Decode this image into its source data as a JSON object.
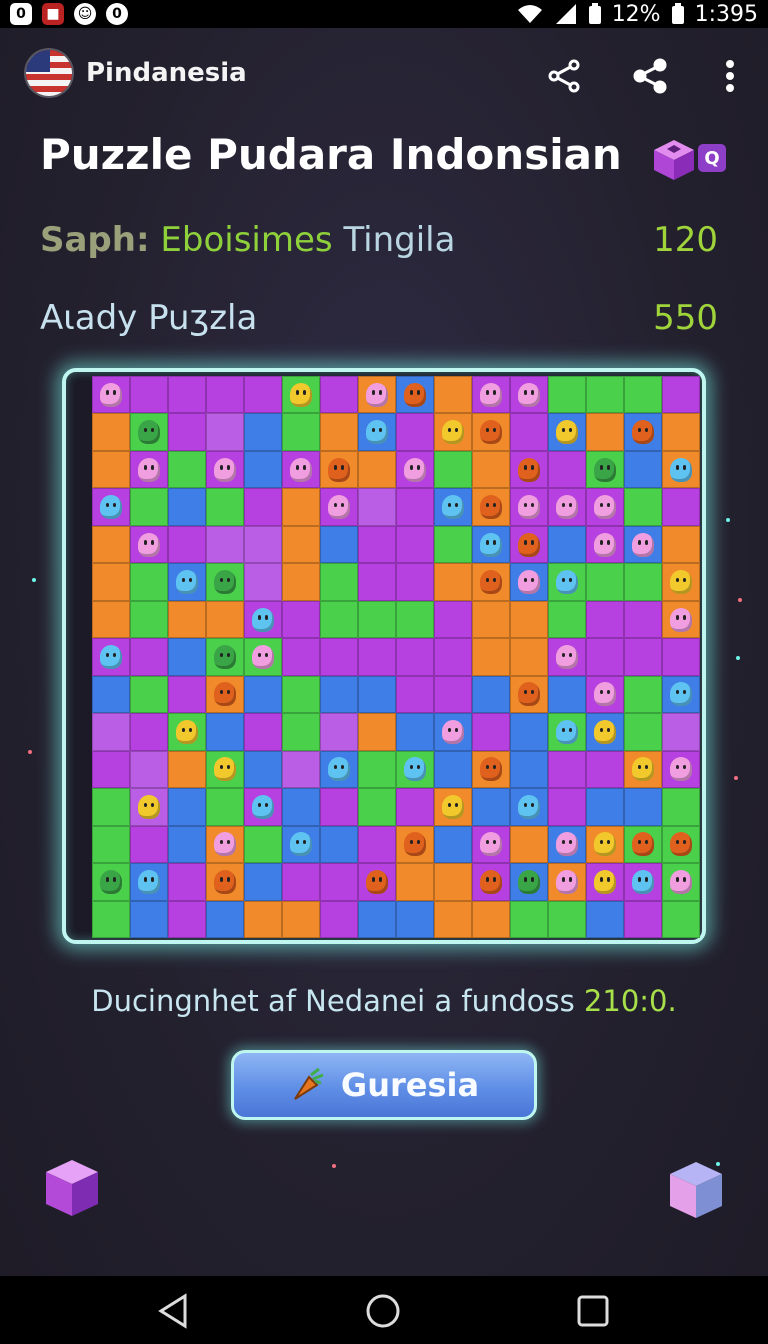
{
  "status_bar": {
    "battery": "12%",
    "time": "1:395"
  },
  "app_bar": {
    "app_name": "Pindanesia"
  },
  "page": {
    "title": "Puzzle Pudara Indonsian",
    "title_badge": "Q"
  },
  "stats": {
    "row1": {
      "label_a": "Saph:",
      "label_b": "Eboisimes",
      "label_c": "Tingila",
      "value": "120"
    },
    "row2": {
      "label": "Aιady Puʒzla",
      "value": "550"
    }
  },
  "footer": {
    "text": "Ducingnhet af Nedanei a fundoss",
    "number": "210:0."
  },
  "action_button": {
    "label": "Guresia"
  },
  "colors": {
    "green": "#4bd04c",
    "purple": "#b640e0",
    "orange": "#f08a2a",
    "blue": "#3f7ee6",
    "violet": "#bb5ee6",
    "glow": "#bff6f0",
    "stat_value": "#9fd43a"
  },
  "board": {
    "rows": [
      "pppppgpoboppggg",
      "ogpmbgobpoopbob",
      "opgpbpoopgoppgb",
      "pgbgpopmpbopppg",
      "oppmmobppgbpbpb",
      "ogbgmogppoobggg",
      "ogooppgggpoogpp",
      "ppbggpppppooppp",
      "bgpobgbbppbobpg",
      "mpgbpgmobbpbgbg",
      "pmogbmbggbobppo",
      "gmbgpbpgpobbpbb",
      "gpbogbbpobpobog",
      "gbpobpppoopbopp",
      "gbpboopbbooggbp"
    ],
    "pieces": [
      "pink",
      "",
      "",
      "",
      "",
      "yellow",
      "",
      "pink",
      "orange",
      "",
      "pink",
      "pink",
      "",
      "",
      "",
      "",
      "",
      "green",
      "",
      "",
      "",
      "",
      "",
      "blue",
      "",
      "yellow",
      "orange",
      "",
      "yellow",
      "",
      "orange",
      "",
      "",
      "pink",
      "",
      "pink",
      "",
      "pink",
      "orange",
      "",
      "pink",
      "",
      "",
      "orange",
      "",
      "green",
      "",
      "blue",
      "blue",
      "",
      "",
      "",
      "",
      "",
      "pink",
      "",
      "",
      "blue",
      "orange",
      "pink",
      "pink",
      "pink",
      "",
      "",
      "",
      "pink",
      "",
      "",
      "",
      "",
      "",
      "",
      "",
      "",
      "blue",
      "orange",
      "",
      "pink",
      "pink",
      "",
      "",
      "",
      "blue",
      "green",
      "",
      "",
      "",
      "",
      "",
      "",
      "orange",
      "pink",
      "blue",
      "",
      "",
      "yellow",
      "",
      "",
      "",
      "",
      "blue",
      "",
      "",
      "",
      "",
      "",
      "",
      "",
      "",
      "",
      "",
      "pink",
      "blue",
      "",
      "",
      "green",
      "pink",
      "",
      "",
      "",
      "",
      "",
      "",
      "",
      "pink",
      "",
      "",
      "",
      "",
      "",
      "",
      "orange",
      "",
      "",
      "",
      "",
      "",
      "",
      "",
      "orange",
      "",
      "pink",
      "",
      "blue",
      "",
      "",
      "yellow",
      "",
      "",
      "",
      "",
      "",
      "",
      "pink",
      "",
      "",
      "blue",
      "yellow",
      "",
      "",
      "",
      "",
      "",
      "yellow",
      "",
      "",
      "blue",
      "",
      "blue",
      "",
      "orange",
      "",
      "",
      "",
      "yellow",
      "pink",
      "",
      "yellow",
      "",
      "",
      "blue",
      "",
      "",
      "",
      "",
      "yellow",
      "",
      "blue",
      "",
      "",
      "",
      "",
      "",
      "",
      "",
      "pink",
      "",
      "blue",
      "",
      "",
      "orange",
      "",
      "pink",
      "",
      "pink",
      "yellow",
      "orange",
      "orange",
      "green",
      "blue",
      "",
      "orange",
      "",
      "",
      "",
      "orange",
      "",
      "",
      "orange",
      "green",
      "pink",
      "yellow",
      "blue",
      "pink",
      "",
      "",
      "",
      "",
      "",
      "",
      "",
      "",
      "",
      "",
      "",
      "",
      "",
      "",
      "",
      ""
    ]
  }
}
